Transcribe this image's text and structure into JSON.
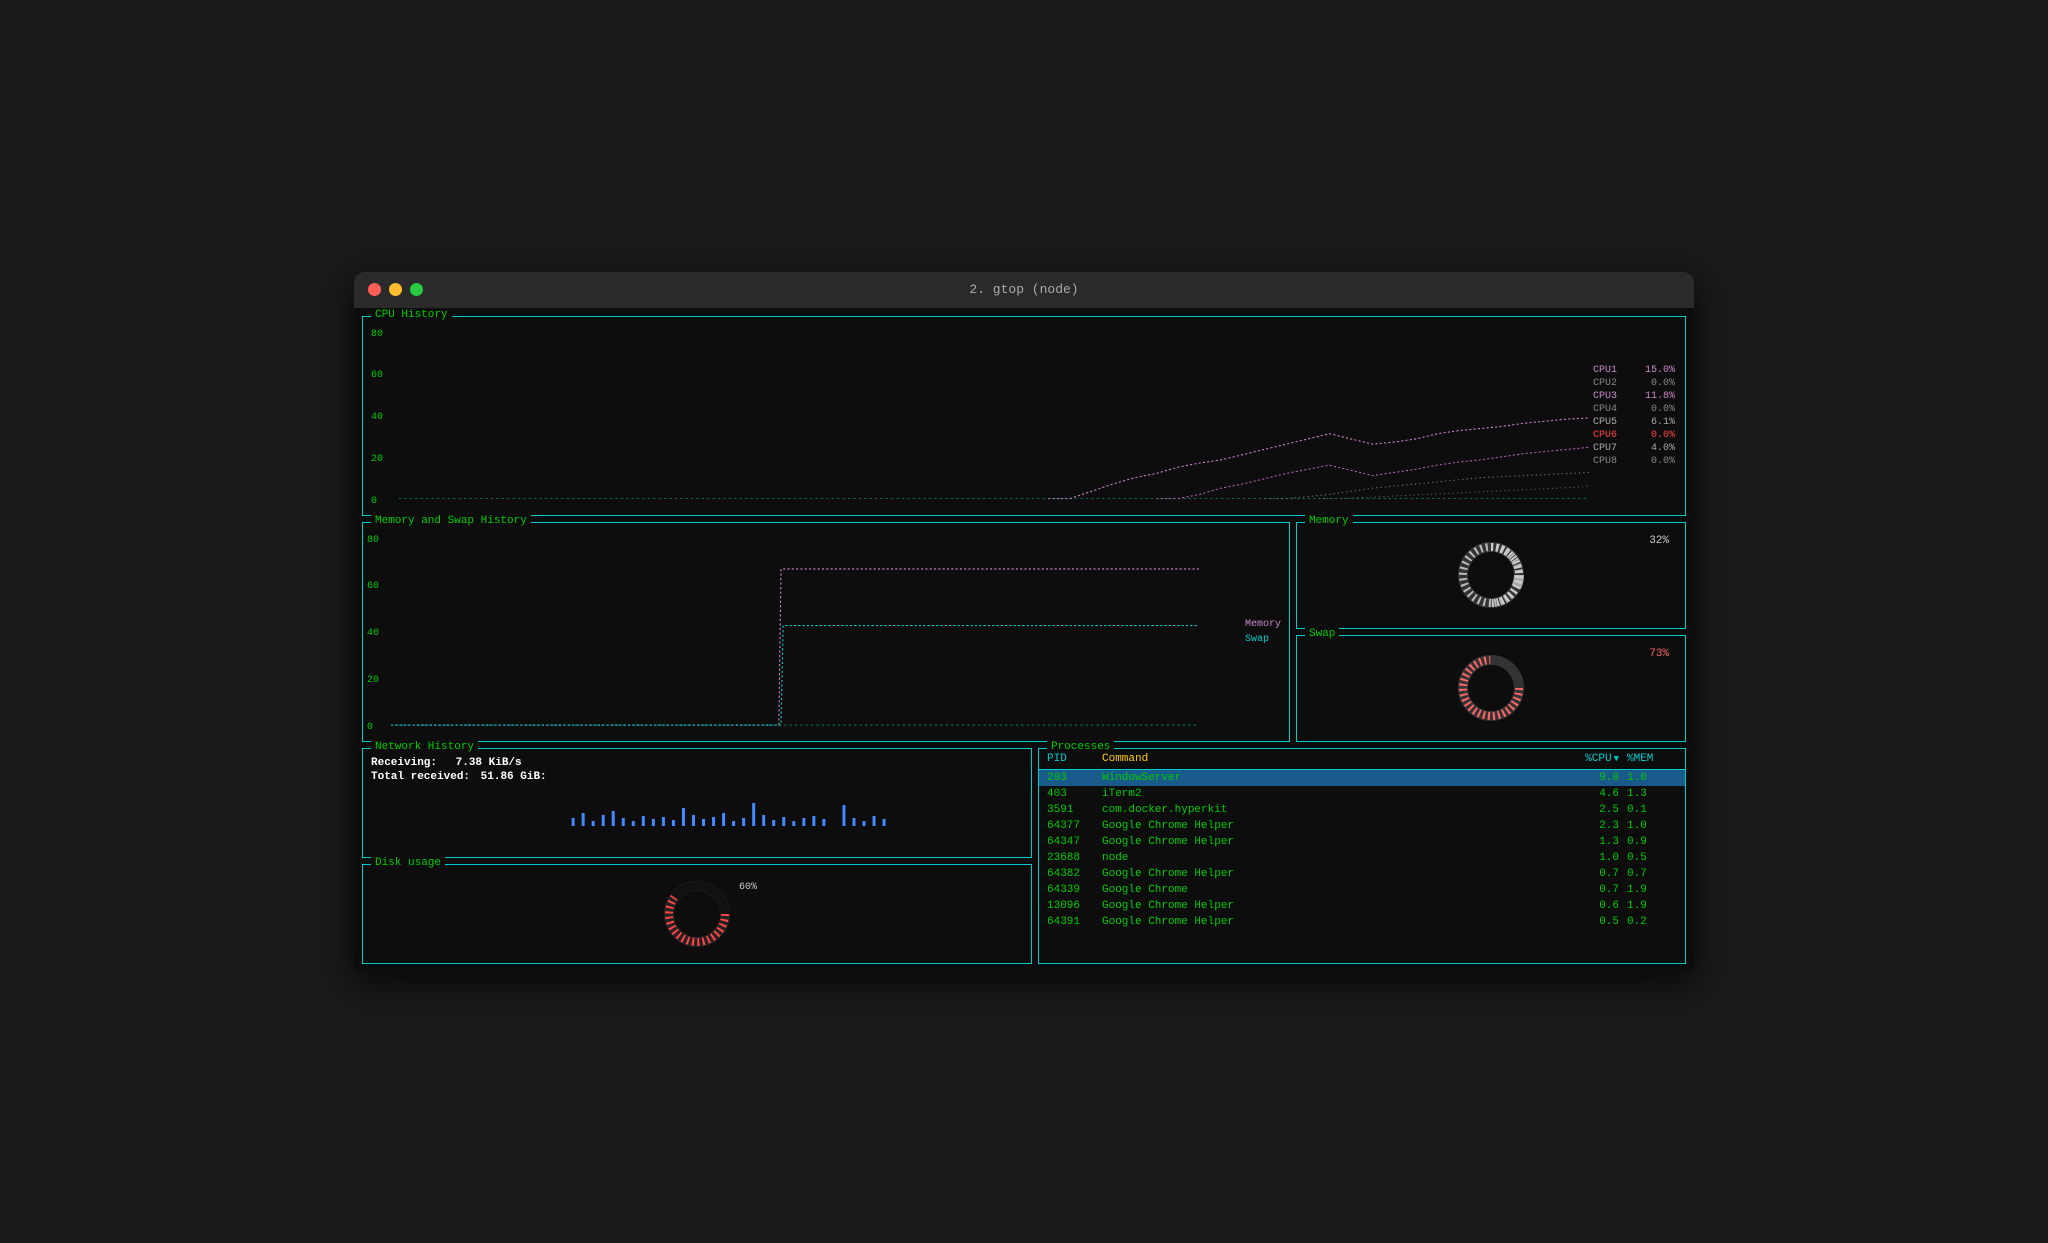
{
  "window": {
    "title": "2. gtop (node)"
  },
  "cpu_history": {
    "title": "CPU History",
    "y_labels": [
      "80",
      "60",
      "40",
      "20",
      "0"
    ],
    "legend": [
      {
        "label": "CPU1",
        "value": "15.0%",
        "color": "#cc88cc"
      },
      {
        "label": "CPU2",
        "value": "0.0%",
        "color": "#cccccc"
      },
      {
        "label": "CPU3",
        "value": "11.8%",
        "color": "#cc88cc"
      },
      {
        "label": "CPU4",
        "value": "0.0%",
        "color": "#cccccc"
      },
      {
        "label": "CPU5",
        "value": "6.1%",
        "color": "#cccccc"
      },
      {
        "label": "CPU6",
        "value": "0.0%",
        "color": "#ff4444"
      },
      {
        "label": "CPU7",
        "value": "4.0%",
        "color": "#cccccc"
      },
      {
        "label": "CPU8",
        "value": "0.0%",
        "color": "#cccccc"
      }
    ]
  },
  "mem_swap_history": {
    "title": "Memory and Swap History",
    "y_labels": [
      "80",
      "60",
      "40",
      "20",
      "0"
    ],
    "legend": [
      {
        "label": "Memory",
        "color": "#cc88cc"
      },
      {
        "label": "Swap",
        "color": "#00cccc"
      }
    ]
  },
  "memory_panel": {
    "title": "Memory",
    "value": "32%",
    "color": "#cccccc"
  },
  "swap_panel": {
    "title": "Swap",
    "value": "73%",
    "color": "#ff6666"
  },
  "network": {
    "title": "Network History",
    "receiving_label": "Receiving:",
    "receiving_value": "7.38 KiB/s",
    "total_label": "Total received:",
    "total_value": "51.86 GiB:"
  },
  "disk": {
    "title": "Disk usage",
    "value": "60%",
    "color": "#ff4444"
  },
  "processes": {
    "title": "Processes",
    "columns": {
      "pid": "PID",
      "command": "Command",
      "cpu": "%CPU",
      "mem": "%MEM"
    },
    "rows": [
      {
        "pid": "203",
        "command": "WindowServer",
        "cpu": "9.0",
        "mem": "1.0",
        "selected": true
      },
      {
        "pid": "403",
        "command": "iTerm2",
        "cpu": "4.6",
        "mem": "1.3",
        "selected": false
      },
      {
        "pid": "3591",
        "command": "com.docker.hyperkit",
        "cpu": "2.5",
        "mem": "0.1",
        "selected": false
      },
      {
        "pid": "64377",
        "command": "Google Chrome Helper",
        "cpu": "2.3",
        "mem": "1.0",
        "selected": false
      },
      {
        "pid": "64347",
        "command": "Google Chrome Helper",
        "cpu": "1.3",
        "mem": "0.9",
        "selected": false
      },
      {
        "pid": "23688",
        "command": "node",
        "cpu": "1.0",
        "mem": "0.5",
        "selected": false
      },
      {
        "pid": "64382",
        "command": "Google Chrome Helper",
        "cpu": "0.7",
        "mem": "0.7",
        "selected": false
      },
      {
        "pid": "64339",
        "command": "Google Chrome",
        "cpu": "0.7",
        "mem": "1.9",
        "selected": false
      },
      {
        "pid": "13096",
        "command": "Google Chrome Helper",
        "cpu": "0.6",
        "mem": "1.9",
        "selected": false
      },
      {
        "pid": "64391",
        "command": "Google Chrome Helper",
        "cpu": "0.5",
        "mem": "0.2",
        "selected": false
      }
    ]
  }
}
